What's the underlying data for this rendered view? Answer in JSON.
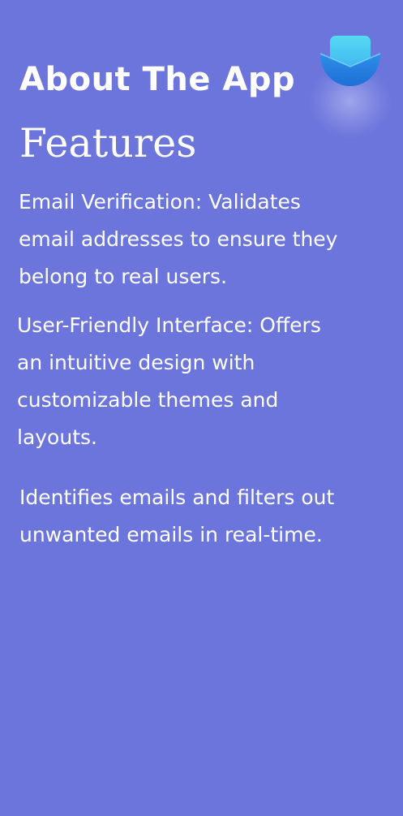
{
  "header": {
    "title": "About The App",
    "app_icon": "app-logo-icon",
    "accent_color": "#3FA8F0",
    "background_color": "#6B75DB"
  },
  "features": {
    "heading": "Features",
    "items": [
      {
        "text": "Email Verification: Validates email addresses to ensure they belong to real users."
      },
      {
        "text": "User-Friendly Interface: Offers an intuitive design with customizable themes and layouts."
      },
      {
        "text": "Identifies emails and filters out unwanted emails in real-time."
      }
    ]
  }
}
